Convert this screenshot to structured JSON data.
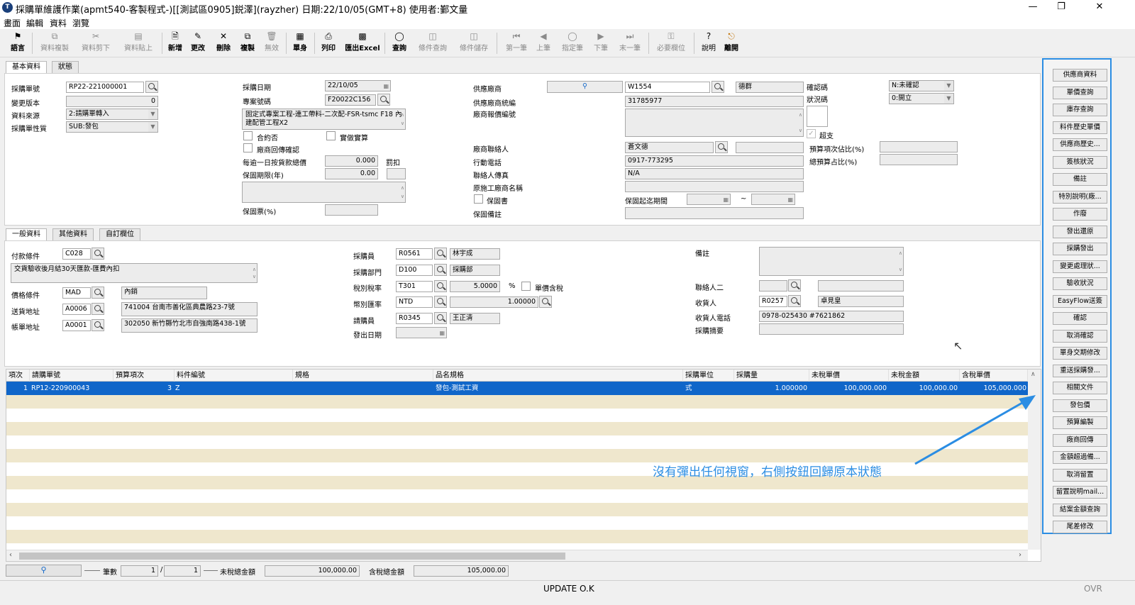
{
  "window": {
    "title": "採購單維護作業(apmt540-客製程式-)[[測試區0905]鋭澤](rayzher) 日期:22/10/05(GMT+8) 使用者:鄞文量",
    "icon": "T"
  },
  "menubar": [
    "畫面",
    "編輯",
    "資料",
    "瀏覽"
  ],
  "toolbar": [
    {
      "label": "語言",
      "icon": "flag-icon",
      "enabled": true
    },
    {
      "label": "資料複製",
      "icon": "copy-icon",
      "enabled": false
    },
    {
      "label": "資料剪下",
      "icon": "scissors-icon",
      "enabled": false
    },
    {
      "label": "資料貼上",
      "icon": "paste-icon",
      "enabled": false
    },
    {
      "label": "新增",
      "icon": "new-file-icon",
      "enabled": true
    },
    {
      "label": "更改",
      "icon": "pencil-icon",
      "enabled": true
    },
    {
      "label": "刪除",
      "icon": "x-icon",
      "enabled": true
    },
    {
      "label": "複製",
      "icon": "duplicate-icon",
      "enabled": true
    },
    {
      "label": "無效",
      "icon": "trash-icon",
      "enabled": false
    },
    {
      "label": "單身",
      "icon": "detail-icon",
      "enabled": true
    },
    {
      "label": "列印",
      "icon": "printer-icon",
      "enabled": true
    },
    {
      "label": "匯出Excel",
      "icon": "excel-icon",
      "enabled": true
    },
    {
      "label": "查詢",
      "icon": "binoculars-icon",
      "enabled": true
    },
    {
      "label": "條件查詢",
      "icon": "filter-query-icon",
      "enabled": false
    },
    {
      "label": "條件儲存",
      "icon": "filter-save-icon",
      "enabled": false
    },
    {
      "label": "第一筆",
      "icon": "first-icon",
      "enabled": false
    },
    {
      "label": "上筆",
      "icon": "prev-icon",
      "enabled": false
    },
    {
      "label": "指定筆",
      "icon": "goto-icon",
      "enabled": false
    },
    {
      "label": "下筆",
      "icon": "next-icon",
      "enabled": false
    },
    {
      "label": "末一筆",
      "icon": "last-icon",
      "enabled": false
    },
    {
      "label": "必要欄位",
      "icon": "key-icon",
      "enabled": false
    },
    {
      "label": "說明",
      "icon": "help-icon",
      "enabled": true
    },
    {
      "label": "離開",
      "icon": "exit-icon",
      "enabled": true
    }
  ],
  "top_tabs": [
    "基本資料",
    "狀態"
  ],
  "basic": {
    "po_no_label": "採購單號",
    "po_no": "RP22-221000001",
    "version_label": "變更版本",
    "version": "0",
    "source_label": "資料來源",
    "source": "2:請購單轉入",
    "nature_label": "採購單性質",
    "nature": "SUB:發包",
    "po_date_label": "採購日期",
    "po_date": "22/10/05",
    "project_label": "專案號碼",
    "project": "F20022C156",
    "project_desc": "固定式專案工程-連工帶料-二次配-FSR-tsmc F18 內建配管工程X2",
    "contract_label": "合約否",
    "prepaid_label": "實做實算",
    "vendor_confirm_label": "廠商回傳確認",
    "overdue_label": "每逾一日按貨款總價",
    "overdue_value": "0.000",
    "penalty_label": "罰扣",
    "warranty_years_label": "保固期限(年)",
    "warranty_years": "0.00",
    "warranty_pct_label": "保固票(%)",
    "supplier_label": "供應廠商",
    "supplier_code": "W1554",
    "supplier_name": "德群",
    "tax_id_label": "供應廠商統編",
    "tax_id": "31785977",
    "quote_no_label": "廠商報價編號",
    "contact_label": "廠商聯絡人",
    "contact": "蒼文德",
    "mobile_label": "行動電話",
    "mobile": "0917-773295",
    "fax_label": "聯絡人傳真",
    "fax": "N/A",
    "orig_vendor_label": "原施工廠商名稱",
    "warranty_doc_label": "保固書",
    "warranty_period_label": "保固起迄期間",
    "tilde": "~",
    "warranty_note_label": "保固備註",
    "confirm_code_label": "確認碼",
    "confirm_code": "N:未確認",
    "status_code_label": "狀況碼",
    "status_code": "0:開立",
    "over_budget_label": "超支",
    "budget_item_pct_label": "預算項次佔比(%)",
    "total_budget_pct_label": "總預算占比(%)"
  },
  "mid_tabs": [
    "一般資料",
    "其他資料",
    "自訂欄位"
  ],
  "general": {
    "payment_label": "付款條件",
    "payment_code": "C028",
    "payment_desc": "交貨驗收後月結30天匯款-匯費內扣",
    "price_label": "價格條件",
    "price_code": "MAD",
    "price_desc": "內銷",
    "ship_label": "送貨地址",
    "ship_code": "A0006",
    "ship_addr": "741004 台南市善化區典農路23-7號",
    "bill_label": "帳單地址",
    "bill_code": "A0001",
    "bill_addr": "302050 新竹縣竹北市自強南路438-1號",
    "buyer_label": "採購員",
    "buyer_code": "R0561",
    "buyer_name": "林宇成",
    "dept_label": "採購部門",
    "dept_code": "D100",
    "dept_name": "採購部",
    "tax_label": "稅別稅率",
    "tax_code": "T301",
    "tax_rate": "5.0000",
    "pct": "%",
    "tax_incl_label": "單價含稅",
    "currency_label": "幣別匯率",
    "currency": "NTD",
    "rate": "1.00000",
    "requester_label": "請購員",
    "requester_code": "R0345",
    "requester_name": "王正清",
    "issue_date_label": "發出日期",
    "remark_label": "備註",
    "contact2_label": "聯絡人二",
    "receiver_label": "收貨人",
    "receiver_code": "R0257",
    "receiver_name": "卓見皇",
    "receiver_phone_label": "收貨人電話",
    "receiver_phone": "0978-025430 #7621862",
    "summary_label": "採購摘要"
  },
  "grid": {
    "headers": [
      "項次",
      "請購單號",
      "預算項次",
      "料件編號",
      "規格",
      "品名規格",
      "採購單位",
      "採購量",
      "未稅單價",
      "未稅金額",
      "含稅單價"
    ],
    "rows": [
      [
        "1",
        "RP12-220900043",
        "3",
        "Z",
        "",
        "發包-測試工資",
        "式",
        "1.000000",
        "100,000.000",
        "100,000.00",
        "105,000.000"
      ]
    ]
  },
  "side_buttons": [
    "供應商資料",
    "單價查詢",
    "庫存查詢",
    "料件歷史單價",
    "供應商歷史...",
    "簽核狀況",
    "備註",
    "特別說明(廠...",
    "作廢",
    "發出還原",
    "採購發出",
    "變更處理狀...",
    "驗收狀況",
    "EasyFlow送簽",
    "確認",
    "取消確認",
    "單身交期修改",
    "重送採購發...",
    "相關文件",
    "發包價",
    "預算編製",
    "廠商回傳",
    "金額超過備...",
    "取消留置",
    "留置說明mail...",
    "結案金額查詢",
    "尾差修改"
  ],
  "annotation": "沒有彈出任何視窗，右側按鈕回歸原本狀態",
  "footer": {
    "count_label": "筆數",
    "current": "1",
    "sep": "/",
    "total": "1",
    "untaxed_total_label": "未稅總金額",
    "untaxed_total": "100,000.00",
    "taxed_total_label": "含稅總金額",
    "taxed_total": "105,000.00"
  },
  "status": {
    "message": "UPDATE O.K",
    "mode": "OVR"
  },
  "colors": {
    "accent": "#2b8de3",
    "selection": "#1066c9",
    "alt_row": "#efe7cd"
  }
}
